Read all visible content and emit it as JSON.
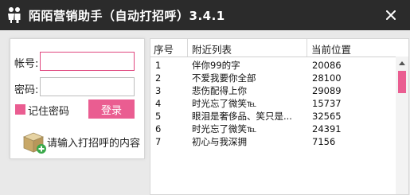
{
  "window": {
    "title": "陌陌营销助手（自动打招呼）3.4.1"
  },
  "login": {
    "account_label": "帐号:",
    "account_value": "",
    "password_label": "密码:",
    "password_value": "",
    "remember_label": "记住密码",
    "login_label": "登录"
  },
  "greeting": {
    "label": "请输入打招呼的内容"
  },
  "table": {
    "headers": [
      "序号",
      "附近列表",
      "当前位置"
    ],
    "rows": [
      {
        "index": "1",
        "name": "伴你99的字",
        "location": "20086"
      },
      {
        "index": "2",
        "name": "不爱我要你全部",
        "location": "28100"
      },
      {
        "index": "3",
        "name": "悲伤配得上你",
        "location": "29089"
      },
      {
        "index": "4",
        "name": "时光忘了微笑℡",
        "location": "15737"
      },
      {
        "index": "5",
        "name": "眼泪是奢侈品、笑只是...",
        "location": "32565"
      },
      {
        "index": "6",
        "name": "时光忘了微笑℡",
        "location": "24391"
      },
      {
        "index": "7",
        "name": "初心与我深拥",
        "location": "7156"
      }
    ]
  },
  "colors": {
    "accent": "#ea5d91",
    "titlebar": "#2b2b2b"
  }
}
